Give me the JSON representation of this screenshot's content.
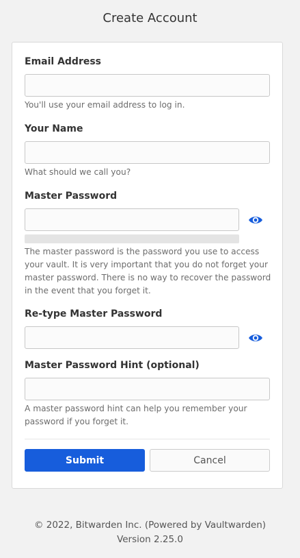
{
  "page": {
    "title": "Create Account"
  },
  "colors": {
    "accent": "#175ddc",
    "background": "#f2f2f2"
  },
  "form": {
    "email": {
      "label": "Email Address",
      "value": "",
      "placeholder": "",
      "help": "You'll use your email address to log in."
    },
    "name": {
      "label": "Your Name",
      "value": "",
      "placeholder": "",
      "help": "What should we call you?"
    },
    "master_password": {
      "label": "Master Password",
      "value": "",
      "placeholder": "",
      "toggle_icon": "eye-icon",
      "strength_percent": 0,
      "help": "The master password is the password you use to access your vault. It is very important that you do not forget your master password. There is no way to recover the password in the event that you forget it."
    },
    "retype_password": {
      "label": "Re-type Master Password",
      "value": "",
      "placeholder": "",
      "toggle_icon": "eye-icon"
    },
    "hint": {
      "label": "Master Password Hint (optional)",
      "value": "",
      "placeholder": "",
      "help": "A master password hint can help you remember your password if you forget it."
    },
    "submit_label": "Submit",
    "cancel_label": "Cancel"
  },
  "footer": {
    "copyright": "© 2022, Bitwarden Inc. (Powered by Vaultwarden)",
    "version": "Version 2.25.0"
  }
}
